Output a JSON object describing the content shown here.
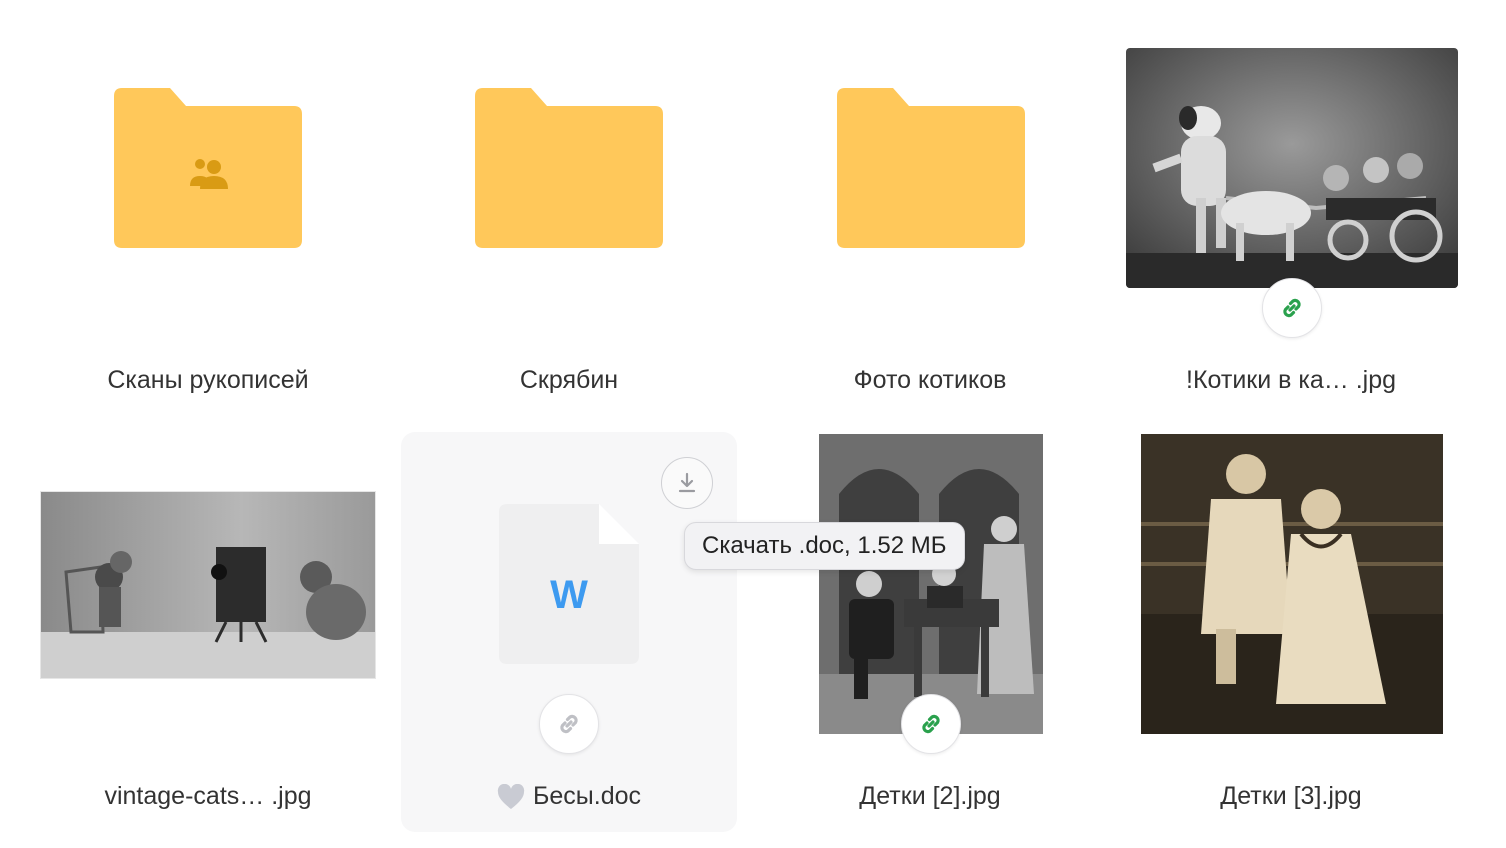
{
  "grid": {
    "items": [
      {
        "label": "Сканы рукописей",
        "kind": "folder",
        "shared": true
      },
      {
        "label": "Скрябин",
        "kind": "folder"
      },
      {
        "label": "Фото котиков",
        "kind": "folder"
      },
      {
        "label": "!Котики в ка… .jpg",
        "kind": "image",
        "public_link": true
      },
      {
        "label": "vintage-cats… .jpg",
        "kind": "image"
      },
      {
        "label": "Бесы.doc",
        "kind": "doc",
        "doc_letter": "W",
        "favorite_icon": "heart-icon"
      },
      {
        "label": "Детки [2].jpg",
        "kind": "image",
        "public_link": true
      },
      {
        "label": "Детки [3].jpg",
        "kind": "image"
      }
    ]
  },
  "tooltip": {
    "text": "Скачать .doc, 1.52 МБ"
  },
  "colors": {
    "folder": "#ffc85a",
    "shared_icon": "#d99b14",
    "link_active": "#2aa14d",
    "link_inactive": "#bfc0c5",
    "doc_w": "#3d9af0"
  }
}
